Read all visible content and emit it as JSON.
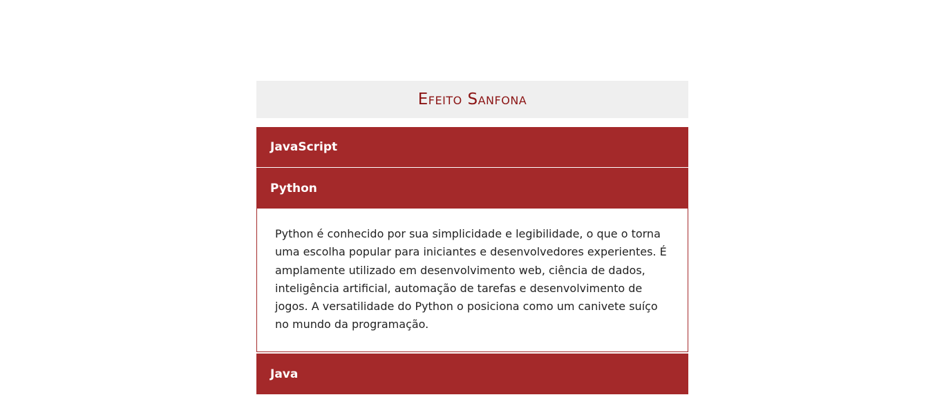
{
  "page": {
    "title": "Efeito Sanfona"
  },
  "accordion": {
    "items": [
      {
        "label": "JavaScript",
        "expanded": false
      },
      {
        "label": "Python",
        "expanded": true,
        "content": "Python é conhecido por sua simplicidade e legibilidade, o que o torna uma escolha popular para iniciantes e desenvolvedores experientes. É amplamente utilizado em desenvolvimento web, ciência de dados, inteligência artificial, automação de tarefas e desenvolvimento de jogos. A versatilidade do Python o posiciona como um canivete suíço no mundo da programação."
      },
      {
        "label": "Java",
        "expanded": false
      }
    ]
  },
  "colors": {
    "header_bg": "#a4292a",
    "title_color": "#8b1414",
    "title_bg": "#efefef"
  }
}
